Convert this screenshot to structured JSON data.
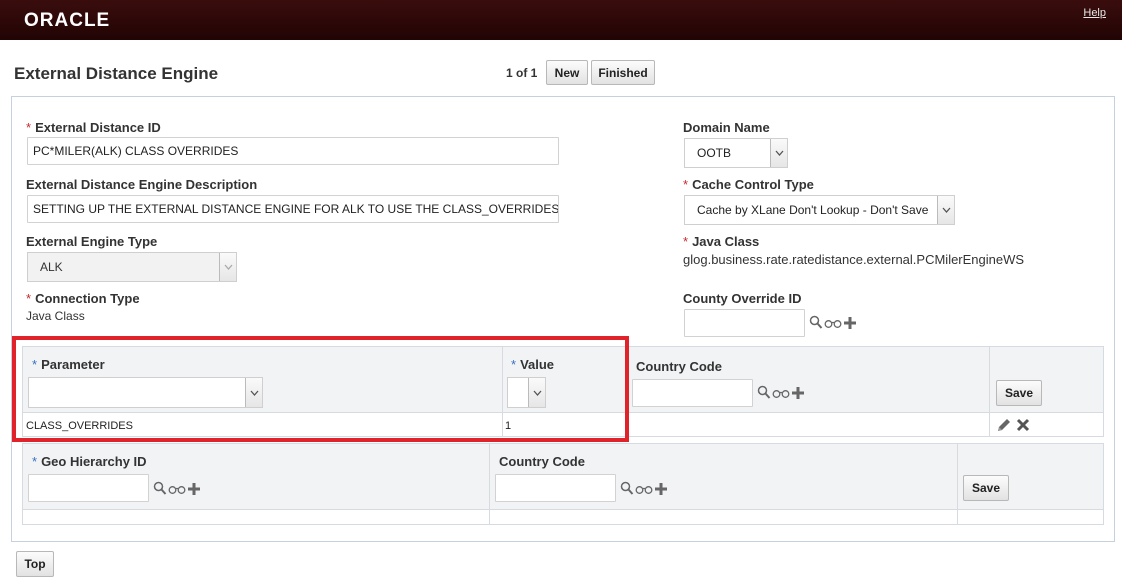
{
  "header": {
    "logo_text": "ORACLE",
    "help_label": "Help"
  },
  "page": {
    "title": "External Distance Engine",
    "pager_text": "1 of 1",
    "new_label": "New",
    "finished_label": "Finished",
    "top_label": "Top"
  },
  "form": {
    "external_distance_id": {
      "label": "External Distance ID",
      "required_mark": "*",
      "value": "PC*MILER(ALK) CLASS OVERRIDES"
    },
    "description": {
      "label": "External Distance Engine Description",
      "value": "SETTING UP THE EXTERNAL DISTANCE ENGINE FOR ALK TO USE THE CLASS_OVERRIDES"
    },
    "engine_type": {
      "label": "External Engine Type",
      "value": "ALK"
    },
    "connection_type": {
      "label": "Connection Type",
      "required_mark": "*",
      "value": "Java Class"
    },
    "domain_name": {
      "label": "Domain Name",
      "value": "OOTB"
    },
    "cache_control": {
      "label": "Cache Control Type",
      "required_mark": "*",
      "value": "Cache by XLane Don't Lookup - Don't Save"
    },
    "java_class": {
      "label": "Java Class",
      "required_mark": "*",
      "value": "glog.business.rate.ratedistance.external.PCMilerEngineWS"
    },
    "county_override": {
      "label": "County Override ID",
      "value": ""
    }
  },
  "parameter_table": {
    "parameter_header": "Parameter",
    "value_header": "Value",
    "country_code_header": "Country Code",
    "required_mark": "*",
    "save_label": "Save",
    "rows": [
      {
        "parameter": "CLASS_OVERRIDES",
        "value": "1"
      }
    ]
  },
  "geo_table": {
    "geo_header": "Geo Hierarchy ID",
    "country_code_header": "Country Code",
    "required_mark": "*",
    "save_label": "Save"
  },
  "colors": {
    "header_bg": "#2a0a0a",
    "required": "#c8282d",
    "required_blue": "#3a6fc0",
    "highlight": "#e0232a"
  }
}
